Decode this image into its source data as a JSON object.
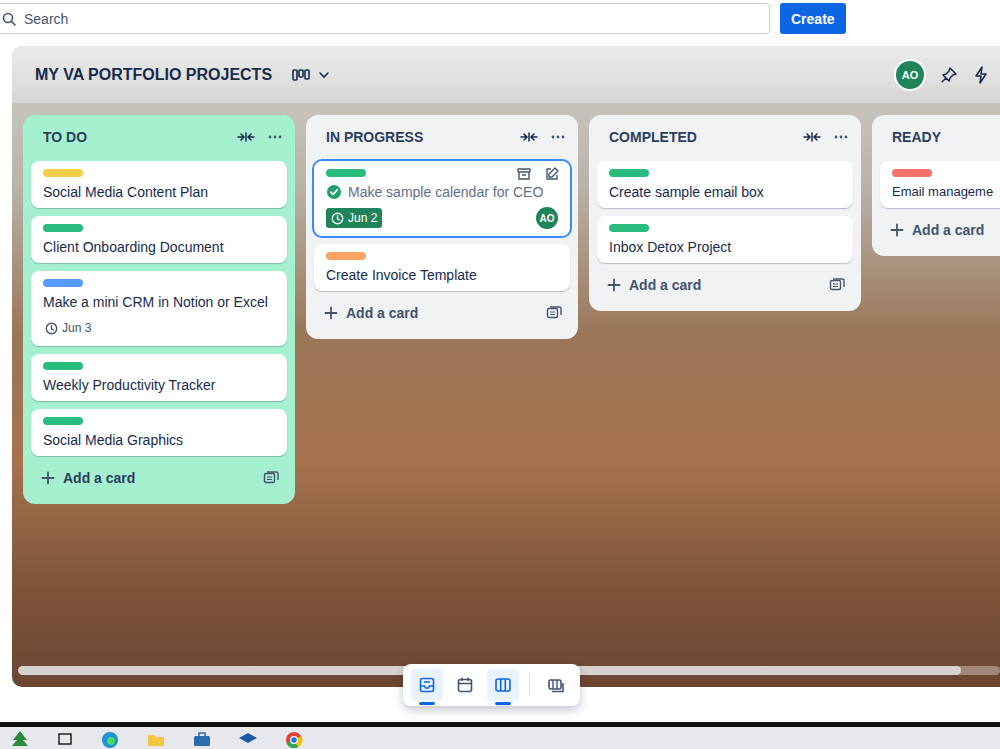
{
  "search": {
    "placeholder": "Search"
  },
  "create_button": "Create",
  "board": {
    "title": "MY VA PORTFOLIO PROJECTS",
    "member": "AO"
  },
  "lists": [
    {
      "title": "TO DO",
      "highlighted": true,
      "add_label": "Add a card",
      "cards": [
        {
          "title": "Social Media Content Plan",
          "color": "#f5cd47",
          "due": null,
          "complete": false,
          "focused": false,
          "member": null
        },
        {
          "title": "Client Onboarding Document",
          "color": "#2abb7f",
          "due": null,
          "complete": false,
          "focused": false,
          "member": null
        },
        {
          "title": "Make a mini CRM in Notion or Excel",
          "color": "#579dff",
          "due": "Jun 3",
          "complete": false,
          "focused": false,
          "member": null
        },
        {
          "title": "Weekly Productivity Tracker",
          "color": "#2abb7f",
          "due": null,
          "complete": false,
          "focused": false,
          "member": null
        },
        {
          "title": "Social Media Graphics",
          "color": "#2abb7f",
          "due": null,
          "complete": false,
          "focused": false,
          "member": null
        }
      ]
    },
    {
      "title": "IN PROGRESS",
      "highlighted": false,
      "add_label": "Add a card",
      "cards": [
        {
          "title": "Make sample calendar for CEO",
          "color": "#2abb7f",
          "due": "Jun 2",
          "complete": true,
          "focused": true,
          "member": "AO"
        },
        {
          "title": "Create Invoice Template",
          "color": "#fea362",
          "due": null,
          "complete": false,
          "focused": false,
          "member": null
        }
      ]
    },
    {
      "title": "COMPLETED",
      "highlighted": false,
      "add_label": "Add a card",
      "cards": [
        {
          "title": "Create sample email box",
          "color": "#2abb7f",
          "due": null,
          "complete": false,
          "focused": false,
          "member": null
        },
        {
          "title": "Inbox Detox Project",
          "color": "#2abb7f",
          "due": null,
          "complete": false,
          "focused": false,
          "member": null
        }
      ]
    },
    {
      "title": "READY",
      "highlighted": false,
      "add_label": "Add a card",
      "cards": [
        {
          "title": "Email manageme",
          "color": "#f87168",
          "due": null,
          "complete": false,
          "focused": false,
          "member": null
        }
      ]
    }
  ],
  "views": [
    {
      "kind": "inbox",
      "selected": true
    },
    {
      "kind": "planner",
      "selected": false
    },
    {
      "kind": "board",
      "selected": true
    },
    {
      "kind": "switch",
      "selected": false
    }
  ]
}
